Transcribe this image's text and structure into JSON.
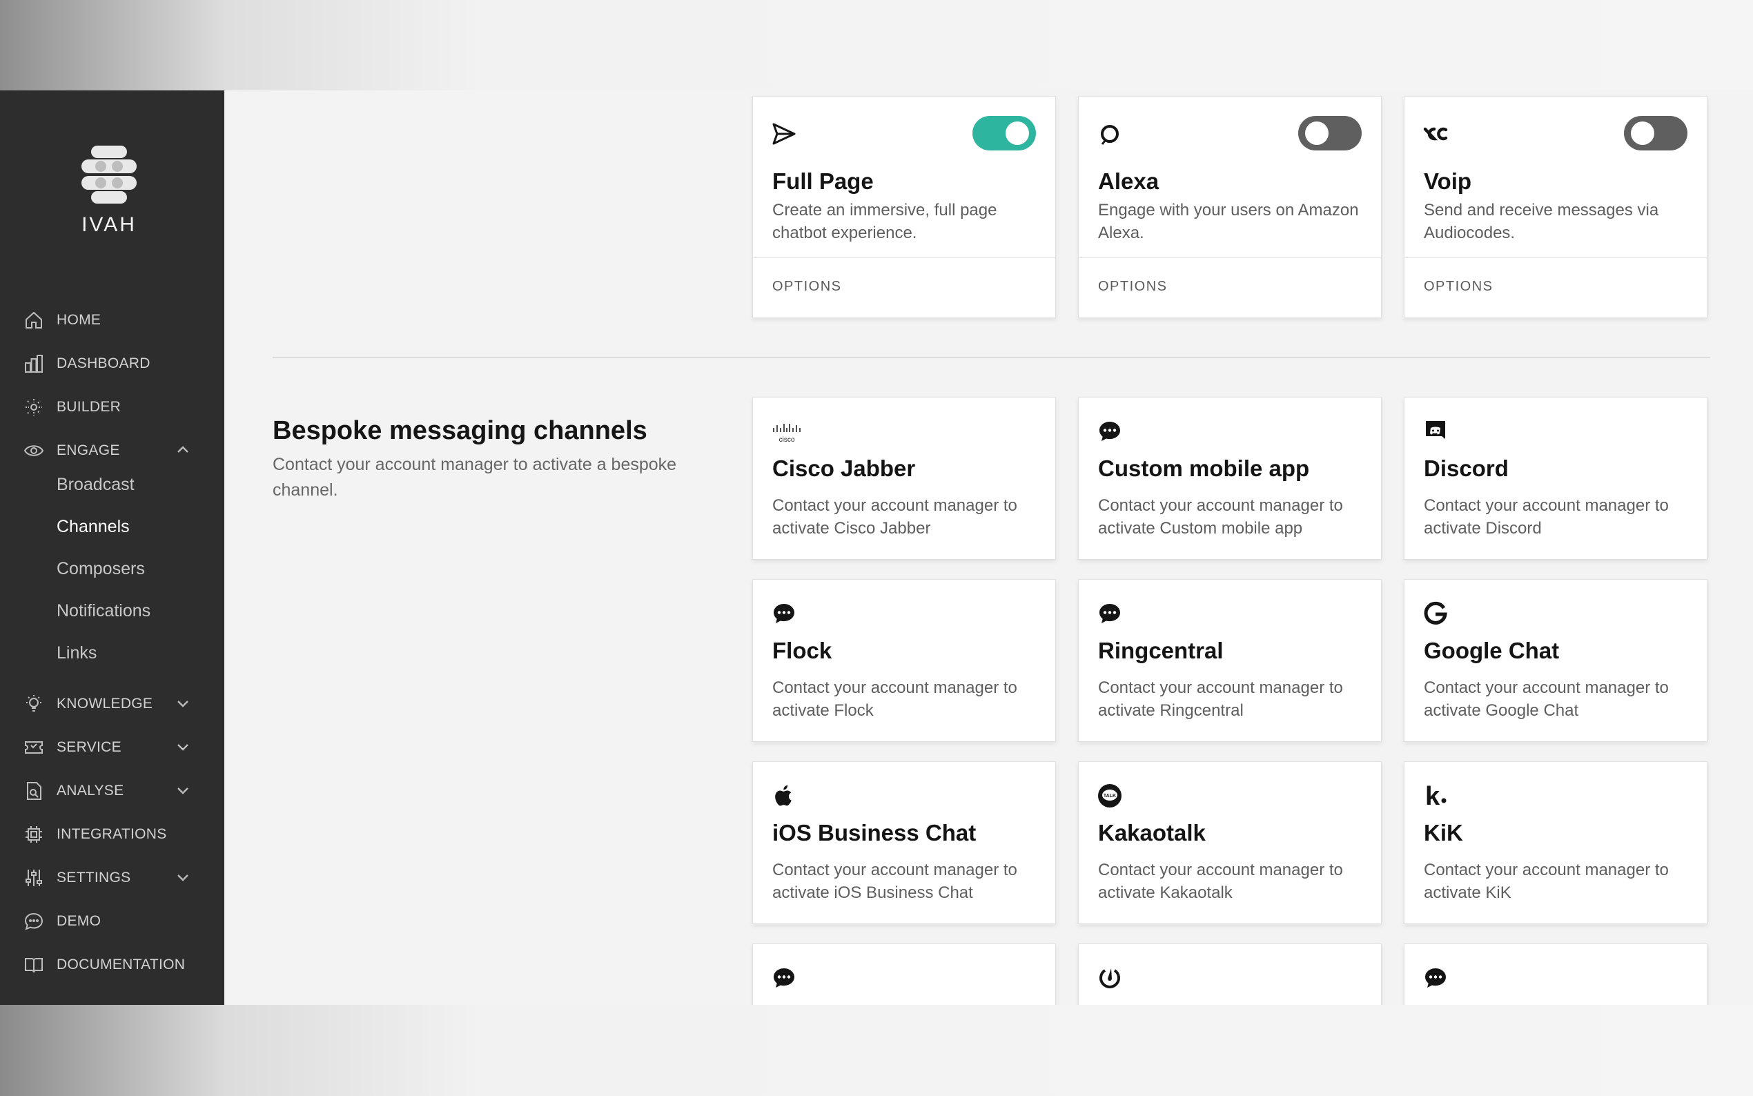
{
  "app": {
    "logo_text": "IVAH"
  },
  "nav": {
    "items": [
      {
        "label": "HOME",
        "icon": "home-icon"
      },
      {
        "label": "DASHBOARD",
        "icon": "bar-chart-icon"
      },
      {
        "label": "BUILDER",
        "icon": "builder-icon"
      },
      {
        "label": "ENGAGE",
        "icon": "eye-icon",
        "expanded": true
      },
      {
        "label": "KNOWLEDGE",
        "icon": "lightbulb-icon"
      },
      {
        "label": "SERVICE",
        "icon": "ticket-icon"
      },
      {
        "label": "ANALYSE",
        "icon": "analyse-icon"
      },
      {
        "label": "INTEGRATIONS",
        "icon": "chip-icon"
      },
      {
        "label": "SETTINGS",
        "icon": "sliders-icon"
      },
      {
        "label": "DEMO",
        "icon": "chat-bubble-icon"
      },
      {
        "label": "DOCUMENTATION",
        "icon": "book-icon"
      }
    ],
    "engage_sub": [
      {
        "label": "Broadcast"
      },
      {
        "label": "Channels",
        "active": true
      },
      {
        "label": "Composers"
      },
      {
        "label": "Notifications"
      },
      {
        "label": "Links"
      }
    ]
  },
  "top_cards": [
    {
      "title": "Full Page",
      "desc": "Create an immersive, full page chatbot experience.",
      "footer": "OPTIONS",
      "enabled": true,
      "icon": "send-icon"
    },
    {
      "title": "Alexa",
      "desc": "Engage with your users on Amazon Alexa.",
      "footer": "OPTIONS",
      "enabled": false,
      "icon": "alexa-icon"
    },
    {
      "title": "Voip",
      "desc": "Send and receive messages via Audiocodes.",
      "footer": "OPTIONS",
      "enabled": false,
      "icon": "audiocodes-icon"
    }
  ],
  "bespoke": {
    "title": "Bespoke messaging channels",
    "desc": "Contact your account manager to activate a bespoke channel.",
    "cards": [
      {
        "title": "Cisco Jabber",
        "desc": "Contact your account manager to activate Cisco Jabber",
        "icon": "cisco-icon",
        "icon_text": "cisco"
      },
      {
        "title": "Custom mobile app",
        "desc": "Contact your account manager to activate Custom mobile app",
        "icon": "chat-dots-icon"
      },
      {
        "title": "Discord",
        "desc": "Contact your account manager to activate Discord",
        "icon": "discord-icon"
      },
      {
        "title": "Flock",
        "desc": "Contact your account manager to activate Flock",
        "icon": "chat-dots-icon"
      },
      {
        "title": "Ringcentral",
        "desc": "Contact your account manager to activate Ringcentral",
        "icon": "chat-dots-icon"
      },
      {
        "title": "Google Chat",
        "desc": "Contact your account manager to activate Google Chat",
        "icon": "google-icon"
      },
      {
        "title": "iOS Business Chat",
        "desc": "Contact your account manager to activate iOS Business Chat",
        "icon": "apple-icon"
      },
      {
        "title": "Kakaotalk",
        "desc": "Contact your account manager to activate Kakaotalk",
        "icon": "kakaotalk-icon",
        "icon_text": "TALK"
      },
      {
        "title": "KiK",
        "desc": "Contact your account manager to activate KiK",
        "icon": "kik-icon",
        "icon_text": "k"
      },
      {
        "title": "",
        "desc": "",
        "icon": "chat-dots-icon"
      },
      {
        "title": "",
        "desc": "",
        "icon": "mattermost-icon"
      },
      {
        "title": "",
        "desc": "",
        "icon": "chat-dots-icon"
      }
    ]
  },
  "colors": {
    "sidebar_bg": "#2d2d2d",
    "toggle_on": "#2eb5a0",
    "toggle_off": "#5f5f5f"
  }
}
